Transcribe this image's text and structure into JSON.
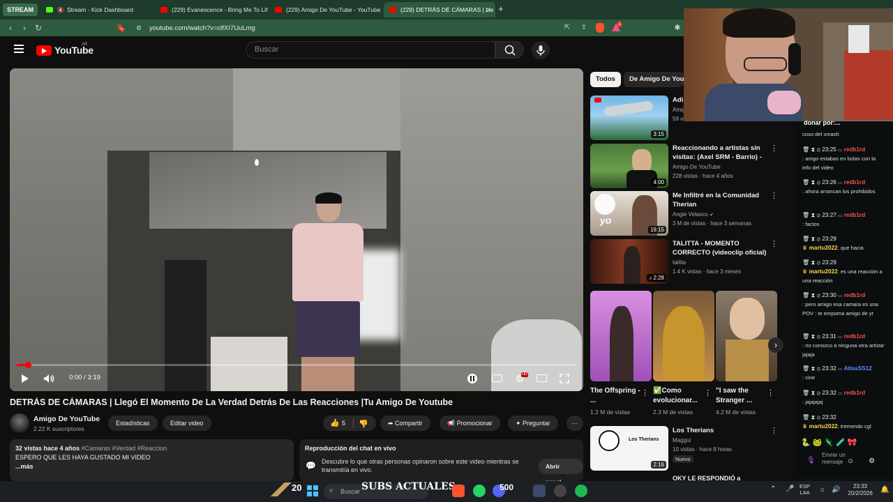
{
  "browser": {
    "stream_label": "STREAM",
    "tabs": [
      {
        "title": "Stream - Kick Dashboard",
        "active": false
      },
      {
        "title": "(229) Evanescence - Bring Me To Life",
        "active": false
      },
      {
        "title": "(229) Amigo De YouTube - YouTube",
        "active": false
      },
      {
        "title": "(229) DETRÁS DE CÁMARAS | Lle",
        "active": true
      }
    ],
    "new_tab": "+",
    "url": "youtube.com/watch?v=clfXI7UuLmg",
    "extension_badge": "1"
  },
  "youtube": {
    "logo_text": "YouTube",
    "country": "AR",
    "search_placeholder": "Buscar"
  },
  "player": {
    "time": "0:00 / 3:19",
    "progress_fraction": 0.02,
    "hd_badge": "HD"
  },
  "video": {
    "title": "DETRÁS DE CÁMARAS | Llegó El Momento De La Verdad Detrás De Las Reacciones |Tu Amigo De Youtube",
    "channel": "Amigo De YouTube",
    "subscribers": "2.22 K suscriptores",
    "buttons": {
      "stats": "Estadísticas",
      "edit": "Editar video",
      "likes": "5",
      "share": "Compartir",
      "promote": "Promocionar",
      "ask": "Preguntar",
      "more": "···"
    },
    "description": {
      "views_date": "32 vistas  hace 4 años",
      "tags": "#Camaras #Verdad #Reaccion",
      "text": "ESPERO QUE LES HAYA GUSTADO MI VIDEO",
      "more": "...más"
    },
    "chat_replay": {
      "title": "Reproducción del chat en vivo",
      "text": "Descubre lo que otras personas opinaron sobre este video mientras se transmitía en vivo.",
      "button": "Abrir panel"
    }
  },
  "sidebar": {
    "chips": [
      "Todos",
      "De Amigo De YouT"
    ],
    "recs": [
      {
        "title": "Adi",
        "channel": "Amig",
        "meta": "59 vi",
        "duration": "3:15"
      },
      {
        "title": "Reaccionando a artistas sin visitas: (Axel SRM - Barrio) - T...",
        "channel": "Amigo De YouTube",
        "meta": "228 vistas · hace 4 años",
        "duration": "4:00"
      },
      {
        "title": "Me Infiltré en la Comunidad Therian",
        "channel": "Angie Velasco",
        "meta": "3 M de vistas · hace 3 semanas",
        "duration": "19:15"
      },
      {
        "title": "TALITTA - MOMENTO CORRECTO (videoclip oficial)",
        "channel": "talitta",
        "meta": "1.4 K vistas · hace 3 meses",
        "duration": "2:28"
      }
    ],
    "shorts": [
      {
        "title": "The Offspring - ...",
        "views": "1.2 M de vistas"
      },
      {
        "title": "✅Como evolucionar...",
        "views": "2.3 M de vistas"
      },
      {
        "title": "\"I saw the Stranger ...",
        "views": "4.2 M de vistas"
      }
    ],
    "rec_last": {
      "title": "Los Therians",
      "channel": "Maggui",
      "meta": "10 vistas · hace 8 horas",
      "badge": "Nuevo",
      "duration": "2:16",
      "thumb_caption": "Los Therians"
    },
    "rec_cut": "OKY LE RESPONDIÓ a"
  },
  "kick_chat": {
    "header": "donar por:...",
    "messages": [
      {
        "time": "",
        "user": "",
        "text": "coso del smash"
      },
      {
        "time": "23:25",
        "user": "redb1rd",
        "text": ": amgo estabas en bolas con la info del video"
      },
      {
        "time": "23:26",
        "user": "redb1rd",
        "text": ": ahora arrancan los prohibidos"
      },
      {
        "time": "23:27",
        "user": "redb1rd",
        "text": ": factos"
      },
      {
        "time": "23:29",
        "user": "martu2022",
        "text": ": que hacia"
      },
      {
        "time": "23:29",
        "user": "martu2022",
        "text": ": es una reacción a una reacción"
      },
      {
        "time": "23:30",
        "user": "redb1rd",
        "text": ": pero amigo esa camara es una POV : te empoma amigo de yt"
      },
      {
        "time": "23:31",
        "user": "redb1rd",
        "text": ": no conozco a ninguna otra artista' jajaja"
      },
      {
        "time": "23:32",
        "user": "AtlasSS12",
        "text": ": cine"
      },
      {
        "time": "23:32",
        "user": "redb1rd",
        "text": ": jajajajaj"
      },
      {
        "time": "23:32",
        "user": "martu2022",
        "text": ": tremendo cgl"
      }
    ],
    "send_placeholder": "Enviar un mensaje"
  },
  "overlay": {
    "subs_label": "SUBS ACTUALES",
    "subs_count": "20",
    "goal": "500"
  },
  "taskbar": {
    "search": "Buscar",
    "lang": "ESP\nLAA",
    "time": "23:33",
    "date": "20/2/2026"
  },
  "colors": {
    "yt_red": "#ff0000",
    "browser_green": "#2e5a3f",
    "kick_green": "#53fc18",
    "chat_user_red": "#ff4d4d",
    "chat_user_gold": "#ffd54a",
    "chat_user_blue": "#5a8cff"
  }
}
